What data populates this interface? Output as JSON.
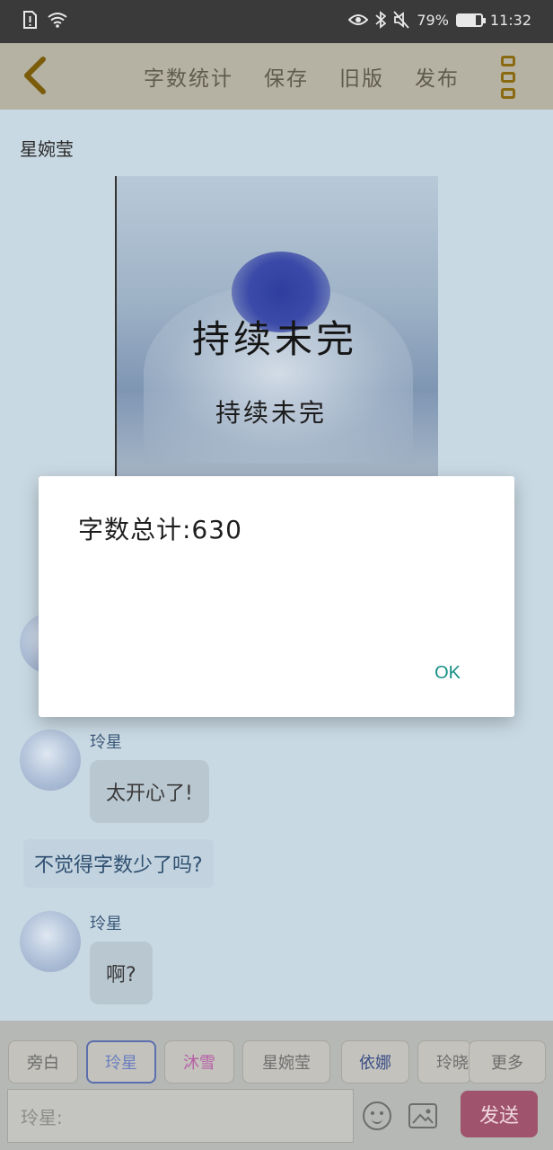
{
  "status_bar": {
    "battery_percent": "79%",
    "battery_level": 0.79,
    "time": "11:32",
    "icons": [
      "sim-alert-icon",
      "wifi-icon",
      "eye-icon",
      "bluetooth-icon",
      "mute-icon",
      "battery-icon"
    ]
  },
  "toolbar": {
    "menu": [
      {
        "id": "word-count",
        "label": "字数统计"
      },
      {
        "id": "save",
        "label": "保存"
      },
      {
        "id": "old-version",
        "label": "旧版"
      },
      {
        "id": "publish",
        "label": "发布"
      }
    ]
  },
  "story": {
    "author_label": "星婉莹",
    "cover_title_big": "持续未完",
    "cover_title_small": "持续未完"
  },
  "messages": [
    {
      "sender": "玲星",
      "text": "太开心了!"
    },
    {
      "narration": "不觉得字数少了吗?"
    },
    {
      "sender": "玲星",
      "text": "啊?"
    }
  ],
  "dialog": {
    "message": "字数总计:630",
    "ok_label": "OK"
  },
  "roles": [
    {
      "label": "旁白",
      "color": "#6a6a6a"
    },
    {
      "label": "玲星",
      "color": "#6b7fbf",
      "active": true
    },
    {
      "label": "沐雪",
      "color": "#b760a5"
    },
    {
      "label": "星婉莹",
      "color": "#6e6e6e"
    },
    {
      "label": "依娜",
      "color": "#3b4f86"
    },
    {
      "label": "玲晓",
      "color": "#6e6e6e"
    },
    {
      "label": "更多",
      "color": "#6e6e6e"
    }
  ],
  "composer": {
    "placeholder": "玲星:",
    "send_label": "发送"
  }
}
